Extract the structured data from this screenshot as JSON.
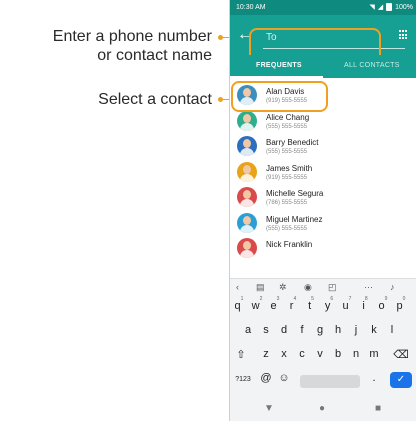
{
  "callouts": {
    "search_line1": "Enter a phone number",
    "search_line2": "or contact name",
    "contact": "Select a contact"
  },
  "status_bar": {
    "time": "10:30 AM",
    "battery": "100%"
  },
  "search": {
    "placeholder": "To"
  },
  "tabs": {
    "frequents": "FREQUENTS",
    "all_contacts": "ALL CONTACTS"
  },
  "contacts": [
    {
      "name": "Alan Davis",
      "number": "(919) 555-5555",
      "color": "#3a8fbf"
    },
    {
      "name": "Alice Chang",
      "number": "(555) 555-5555",
      "color": "#2eae8f"
    },
    {
      "name": "Barry Benedict",
      "number": "(555) 555-5555",
      "color": "#2c6fbf"
    },
    {
      "name": "James Smith",
      "number": "(919) 555-5555",
      "color": "#e8a317"
    },
    {
      "name": "Michelle Segura",
      "number": "(786) 555-5555",
      "color": "#d94b4b"
    },
    {
      "name": "Miguel Martinez",
      "number": "(555) 555-5555",
      "color": "#2a9fd6"
    },
    {
      "name": "Nick Franklin",
      "number": "",
      "color": "#d94b4b"
    }
  ],
  "keyboard": {
    "row1": [
      "q",
      "w",
      "e",
      "r",
      "t",
      "y",
      "u",
      "i",
      "o",
      "p"
    ],
    "row1_hints": [
      "1",
      "2",
      "3",
      "4",
      "5",
      "6",
      "7",
      "8",
      "9",
      "0"
    ],
    "row2": [
      "a",
      "s",
      "d",
      "f",
      "g",
      "h",
      "j",
      "k",
      "l"
    ],
    "row3": [
      "z",
      "x",
      "c",
      "v",
      "b",
      "n",
      "m"
    ],
    "symbols_key": "?123",
    "at_key": "@",
    "period_key": "."
  },
  "colors": {
    "accent": "#16a094",
    "callout": "#f0a020",
    "enter": "#1a73e8"
  }
}
